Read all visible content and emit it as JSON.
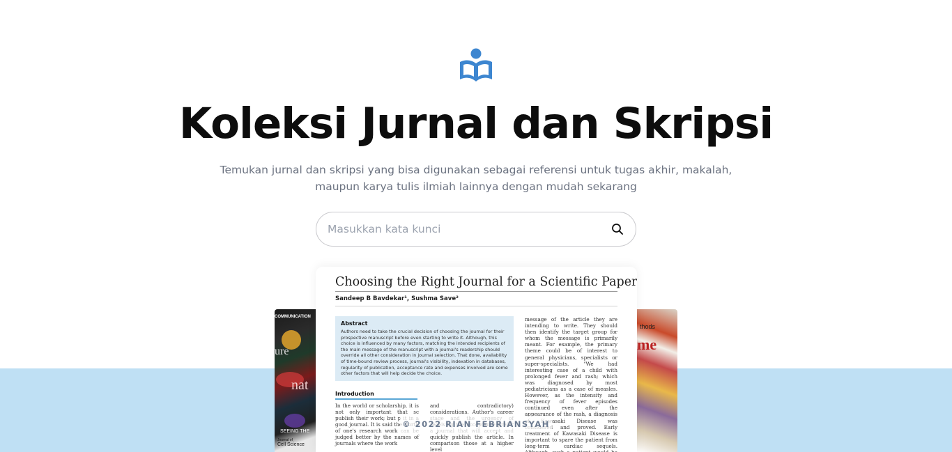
{
  "hero": {
    "title": "Koleksi Jurnal dan Skripsi",
    "subtitle_line1": "Temukan jurnal dan skripsi yang bisa digunakan sebagai referensi untuk tugas akhir, makalah,",
    "subtitle_line2": "maupun karya tulis ilmiah lainnya dengan mudah sekarang"
  },
  "search": {
    "placeholder": "Masukkan kata kunci",
    "value": ""
  },
  "paper": {
    "title": "Choosing the Right Journal for a Scientific Paper",
    "authors": "Sandeep B Bavdekar¹, Sushma Save²",
    "abstract_heading": "Abstract",
    "abstract_text": "Authors need to take the crucial decision of choosing the journal for their prospective manuscript before even starting to write it. Although, this choice is influenced by many factors, matching the intended recipients of the main message of the manuscript with a journal's readership should override all other consideration in journal selection. That done, availability of time-bound review process, journal's visibility, indexation in databases, regularity of publication, acceptance rate and expenses involved are some other factors that will help decide the choice.",
    "intro_heading": "Introduction",
    "intro_col1": "In the world or scholarship, it is not only important that sc publish their work; but p it in a good journal. It is said the worth of one's research work can be judged better by the names of journals where the work",
    "intro_col2": "and contradictory) considerations. Author's career stage and the urgency of receiving the acceptance prefer a journal that will accept and quickly publish the article. In comparison those at a higher level",
    "right_col": "message of the article they are intending to write. They should then identify the target group for whom the message is primarily meant. For example, the primary theme could be of interest to general physicians, specialists or super-specialists. \"We had interesting case of a child with prolonged fever and rash; which was diagnosed by most pediatricians as a case of measles. However, as the intensity and frequency of fever episodes continued even after the appearance of the rash, a diagnosis of Kawasaki Disease was considered and proved. Early treatment of Kawasaki Disease is important to spare the patient from long-term cardiac sequels. Although, such a patient would be managed by a pediatrician, we"
  },
  "cover_left": {
    "labels": [
      "COMMUNICATION",
      "ure",
      "nat",
      "SEEING THE",
      "Journal of",
      "Cell Science"
    ]
  },
  "cover_right": {
    "labels": [
      "thods",
      "me"
    ]
  },
  "footer": {
    "copyright": "© 2022 RIAN FEBRIANSYAH"
  },
  "colors": {
    "accent": "#3d86d0",
    "band": "#bfe0f4",
    "title": "#0d0d0d",
    "muted": "#6b7280"
  },
  "icons": {
    "logo": "reading-book-icon",
    "search": "search-icon"
  }
}
